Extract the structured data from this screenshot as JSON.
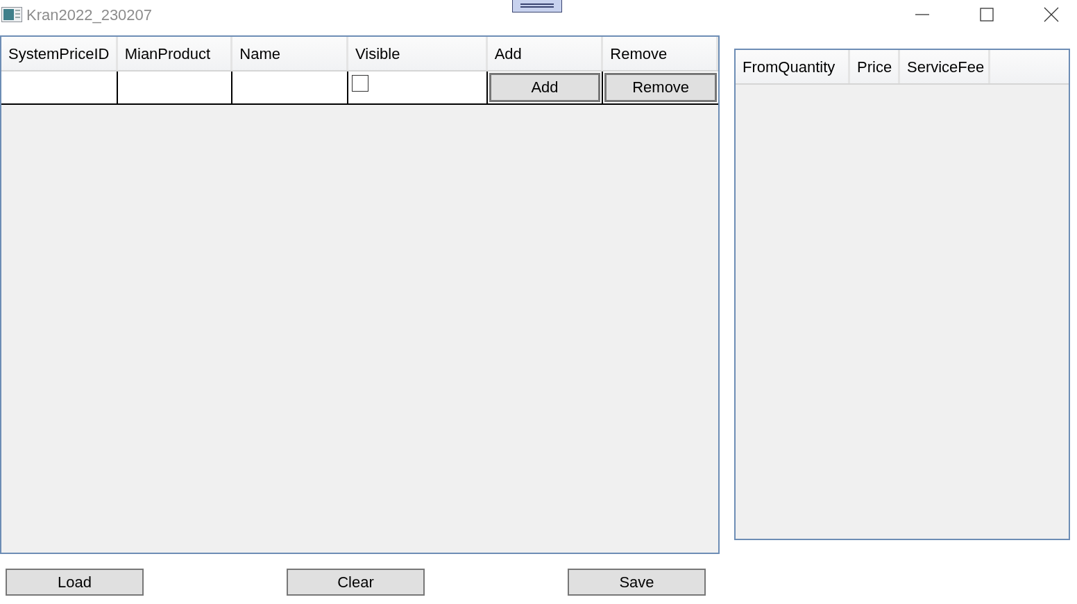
{
  "window": {
    "title": "Kran2022_230207"
  },
  "price_grid": {
    "columns": [
      "SystemPriceID",
      "MianProduct",
      "Name",
      "Visible",
      "Add",
      "Remove"
    ],
    "rows": [
      {
        "visible": false,
        "add": "Add",
        "remove": "Remove"
      }
    ]
  },
  "quantity_grid": {
    "columns": [
      "FromQuantity",
      "Price",
      "ServiceFee"
    ]
  },
  "buttons": [
    "Load",
    "Clear",
    "Save"
  ]
}
